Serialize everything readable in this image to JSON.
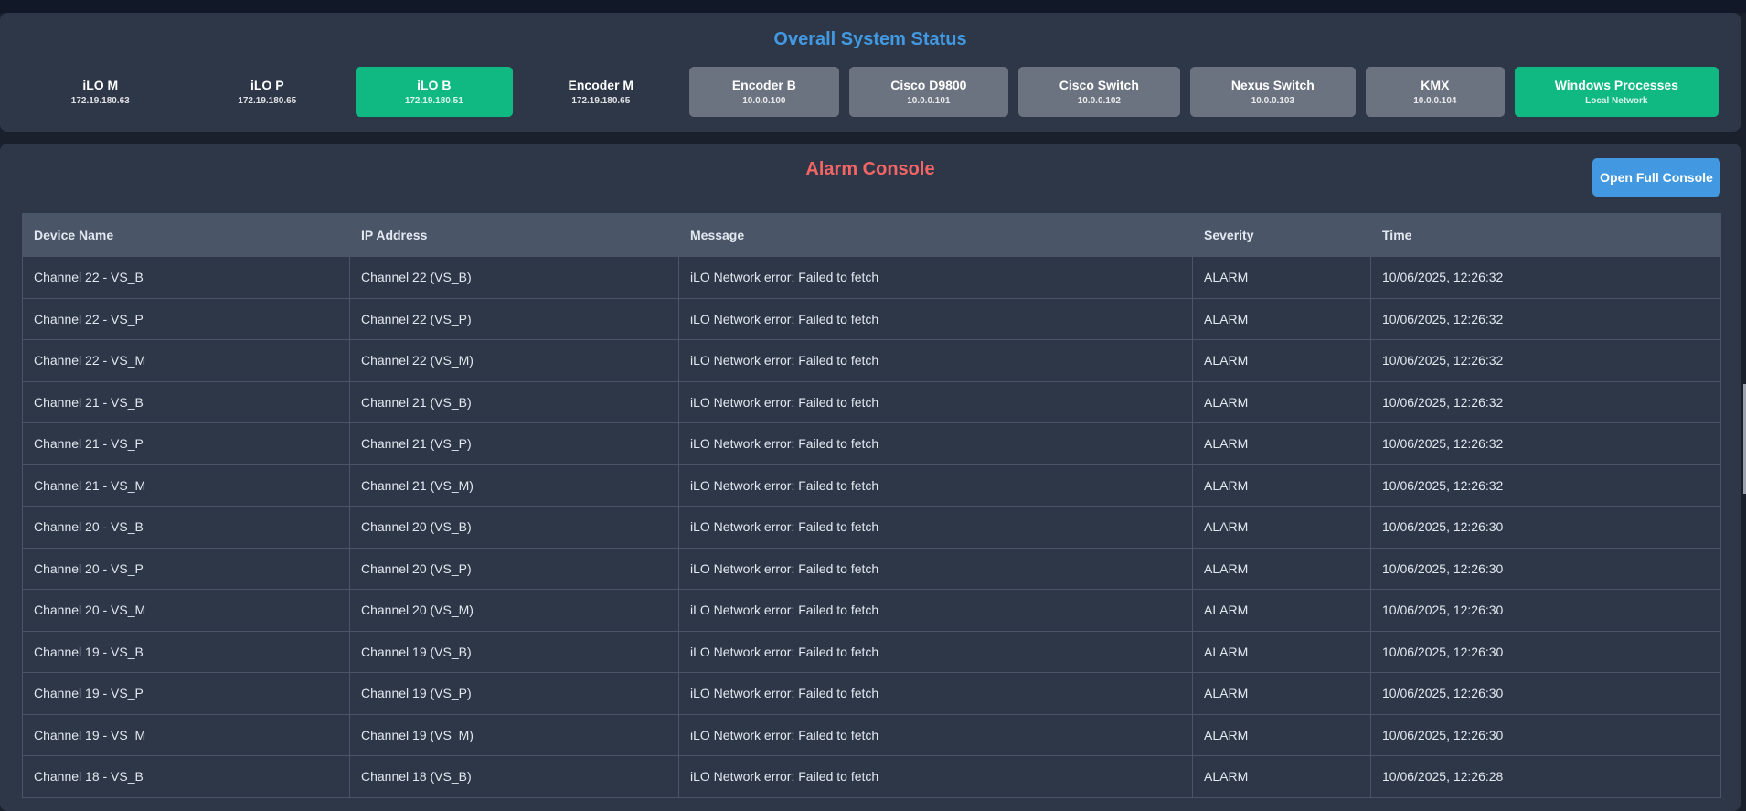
{
  "status": {
    "title": "Overall System Status",
    "colors": {
      "warning": "#f59e0b",
      "ok": "#10b981",
      "unknown": "#6b7280"
    },
    "tiles": [
      {
        "name": "iLO M",
        "ip": "172.19.180.63",
        "state": "warning"
      },
      {
        "name": "iLO P",
        "ip": "172.19.180.65",
        "state": "warning"
      },
      {
        "name": "iLO B",
        "ip": "172.19.180.51",
        "state": "ok"
      },
      {
        "name": "Encoder M",
        "ip": "172.19.180.65",
        "state": "warning"
      },
      {
        "name": "Encoder B",
        "ip": "10.0.0.100",
        "state": "unknown"
      },
      {
        "name": "Cisco D9800",
        "ip": "10.0.0.101",
        "state": "unknown"
      },
      {
        "name": "Cisco Switch",
        "ip": "10.0.0.102",
        "state": "unknown"
      },
      {
        "name": "Nexus Switch",
        "ip": "10.0.0.103",
        "state": "unknown"
      },
      {
        "name": "KMX",
        "ip": "10.0.0.104",
        "state": "unknown"
      },
      {
        "name": "Windows Processes",
        "ip": "Local Network",
        "state": "ok"
      }
    ]
  },
  "alarm_console": {
    "title": "Alarm Console",
    "open_button_label": "Open Full Console",
    "columns": [
      "Device Name",
      "IP Address",
      "Message",
      "Severity",
      "Time"
    ],
    "rows": [
      [
        "Channel 22 - VS_B",
        "Channel 22 (VS_B)",
        "iLO Network error: Failed to fetch",
        "ALARM",
        "10/06/2025, 12:26:32"
      ],
      [
        "Channel 22 - VS_P",
        "Channel 22 (VS_P)",
        "iLO Network error: Failed to fetch",
        "ALARM",
        "10/06/2025, 12:26:32"
      ],
      [
        "Channel 22 - VS_M",
        "Channel 22 (VS_M)",
        "iLO Network error: Failed to fetch",
        "ALARM",
        "10/06/2025, 12:26:32"
      ],
      [
        "Channel 21 - VS_B",
        "Channel 21 (VS_B)",
        "iLO Network error: Failed to fetch",
        "ALARM",
        "10/06/2025, 12:26:32"
      ],
      [
        "Channel 21 - VS_P",
        "Channel 21 (VS_P)",
        "iLO Network error: Failed to fetch",
        "ALARM",
        "10/06/2025, 12:26:32"
      ],
      [
        "Channel 21 - VS_M",
        "Channel 21 (VS_M)",
        "iLO Network error: Failed to fetch",
        "ALARM",
        "10/06/2025, 12:26:32"
      ],
      [
        "Channel 20 - VS_B",
        "Channel 20 (VS_B)",
        "iLO Network error: Failed to fetch",
        "ALARM",
        "10/06/2025, 12:26:30"
      ],
      [
        "Channel 20 - VS_P",
        "Channel 20 (VS_P)",
        "iLO Network error: Failed to fetch",
        "ALARM",
        "10/06/2025, 12:26:30"
      ],
      [
        "Channel 20 - VS_M",
        "Channel 20 (VS_M)",
        "iLO Network error: Failed to fetch",
        "ALARM",
        "10/06/2025, 12:26:30"
      ],
      [
        "Channel 19 - VS_B",
        "Channel 19 (VS_B)",
        "iLO Network error: Failed to fetch",
        "ALARM",
        "10/06/2025, 12:26:30"
      ],
      [
        "Channel 19 - VS_P",
        "Channel 19 (VS_P)",
        "iLO Network error: Failed to fetch",
        "ALARM",
        "10/06/2025, 12:26:30"
      ],
      [
        "Channel 19 - VS_M",
        "Channel 19 (VS_M)",
        "iLO Network error: Failed to fetch",
        "ALARM",
        "10/06/2025, 12:26:30"
      ],
      [
        "Channel 18 - VS_B",
        "Channel 18 (VS_B)",
        "iLO Network error: Failed to fetch",
        "ALARM",
        "10/06/2025, 12:26:28"
      ]
    ]
  }
}
